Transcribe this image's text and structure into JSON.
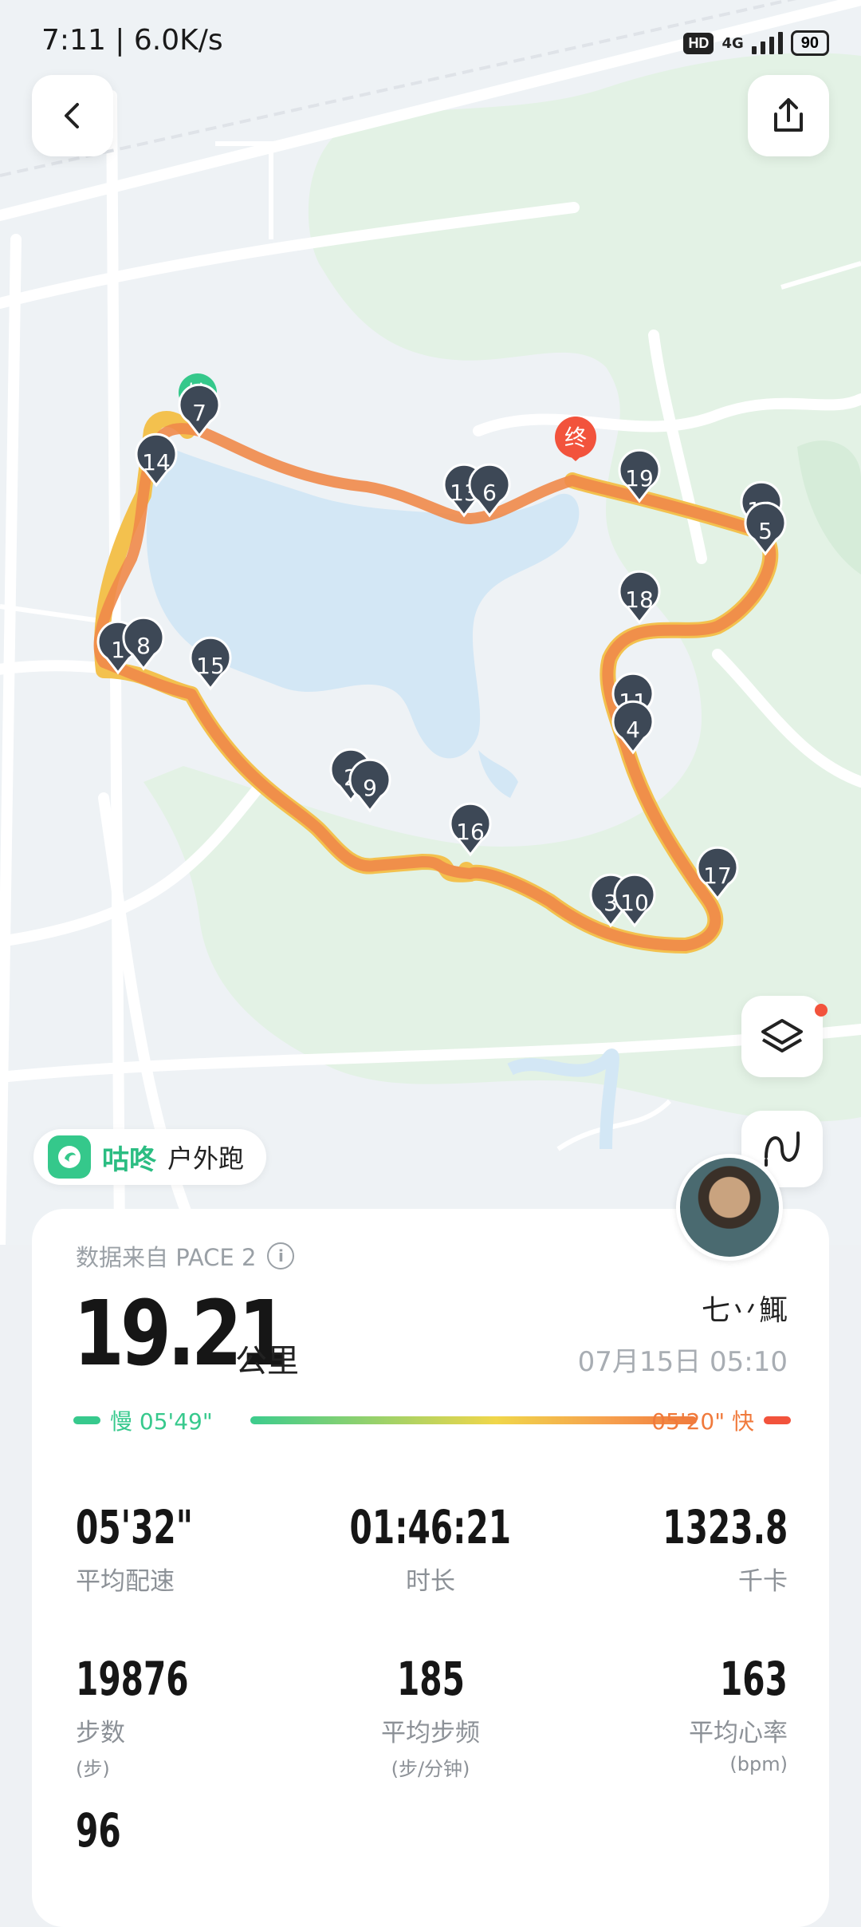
{
  "status_bar": {
    "time_speed": "7:11 | 6.0K/s",
    "hd": "HD",
    "network": "4G",
    "battery": "90"
  },
  "map": {
    "start_label": "始",
    "end_label": "终",
    "markers": [
      "7",
      "14",
      "13",
      "6",
      "19",
      "12",
      "5",
      "18",
      "1",
      "8",
      "15",
      "11",
      "4",
      "2",
      "9",
      "16",
      "3",
      "10",
      "17"
    ]
  },
  "brand": {
    "name": "咕咚",
    "activity": "户外跑"
  },
  "card": {
    "source": "数据来自 PACE 2",
    "info_glyph": "i",
    "distance": "19.21",
    "distance_unit": "公里",
    "user_name": "七丷鮿",
    "date_time": "07月15日 05:10",
    "pace_slow": "慢 05'49\"",
    "pace_fast": "05'20\" 快",
    "stats": [
      {
        "value": "05'32\"",
        "label": "平均配速",
        "sub": ""
      },
      {
        "value": "01:46:21",
        "label": "时长",
        "sub": ""
      },
      {
        "value": "1323.8",
        "label": "千卡",
        "sub": ""
      },
      {
        "value": "19876",
        "label": "步数",
        "sub": "(步)"
      },
      {
        "value": "185",
        "label": "平均步频",
        "sub": "(步/分钟)"
      },
      {
        "value": "163",
        "label": "平均心率",
        "sub": "(bpm)"
      },
      {
        "value": "96",
        "label": "",
        "sub": ""
      }
    ]
  },
  "colors": {
    "brand_green": "#2bbd82",
    "route_orange": "#ef8a4a",
    "route_yellow": "#f3c14e",
    "marker_dark": "#3d4856",
    "end_red": "#f2533c"
  }
}
